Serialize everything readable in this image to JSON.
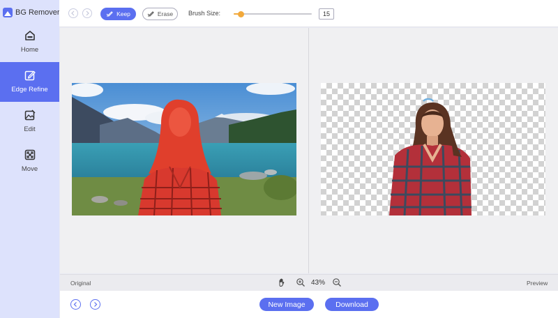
{
  "app": {
    "title": "BG Remover"
  },
  "sidebar": {
    "items": [
      {
        "label": "Home",
        "icon": "home-icon"
      },
      {
        "label": "Edge Refine",
        "icon": "edge-refine-icon",
        "active": true
      },
      {
        "label": "Edit",
        "icon": "edit-image-icon"
      },
      {
        "label": "Move",
        "icon": "move-arrows-icon"
      }
    ]
  },
  "toolbar": {
    "keep_label": "Keep",
    "erase_label": "Erase",
    "brush_label": "Brush Size:",
    "brush_value": "15",
    "brush_fraction": 0.09
  },
  "zoom": {
    "original_label": "Original",
    "preview_label": "Preview",
    "value": "43%"
  },
  "actions": {
    "new_image_label": "New Image",
    "download_label": "Download"
  },
  "colors": {
    "accent": "#5b6ff0",
    "sidebar_bg": "#dde2fc",
    "slider": "#f2a93b"
  }
}
